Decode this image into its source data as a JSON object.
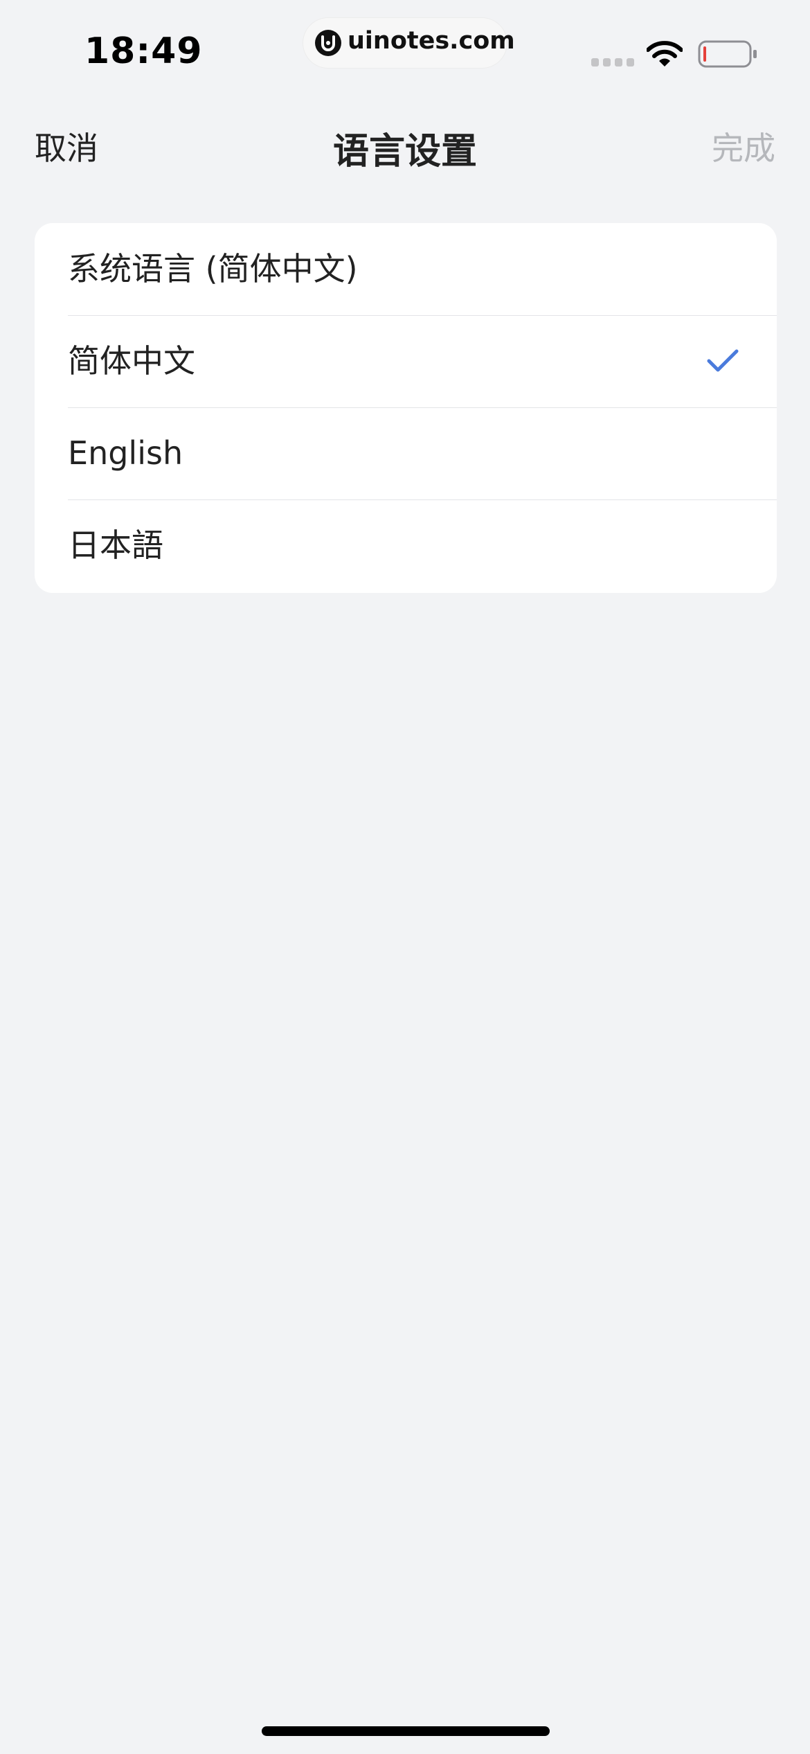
{
  "status_bar": {
    "time": "18:49",
    "watermark": "uinotes.com",
    "icons": [
      "signal-icon",
      "wifi-icon",
      "battery-icon"
    ]
  },
  "nav": {
    "cancel_label": "取消",
    "title": "语言设置",
    "done_label": "完成"
  },
  "languages": [
    {
      "label": "系统语言 (简体中文)",
      "selected": false
    },
    {
      "label": "简体中文",
      "selected": true
    },
    {
      "label": "English",
      "selected": false
    },
    {
      "label": "日本語",
      "selected": false
    }
  ],
  "colors": {
    "background": "#f2f3f5",
    "card": "#ffffff",
    "text": "#222222",
    "done_disabled": "#b5b7bb",
    "check_accent": "#4a7bdc",
    "battery_low": "#e5403a"
  }
}
